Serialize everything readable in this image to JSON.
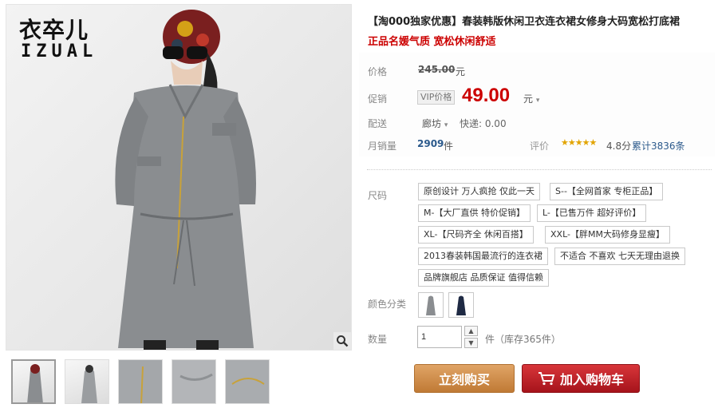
{
  "gallery": {
    "brand_cn": "衣卒儿",
    "brand_en": "IZUAL",
    "zoom_icon": "magnifier-icon",
    "thumbnails": [
      "thumb-1",
      "thumb-2",
      "thumb-3",
      "thumb-4",
      "thumb-5"
    ]
  },
  "product": {
    "title": "【淘000独家优惠】春装韩版休闲卫衣连衣裙女修身大码宽松打底裙",
    "subtitle": "正品名媛气质 宽松休闲舒适"
  },
  "price": {
    "label": "价格",
    "original": "245.00",
    "original_unit": "元",
    "promo_label": "促销",
    "vip_tag": "VIP价格",
    "current": "49.00",
    "current_unit": "元"
  },
  "shipping": {
    "label": "配送",
    "location": "廊坊",
    "express": "快递: 0.00"
  },
  "sales": {
    "label": "月销量",
    "count": "2909",
    "unit": "件",
    "review_label": "评价",
    "stars": "★★★★★",
    "rating": 4.8,
    "score": "4.8分",
    "reviews": "累计3836条"
  },
  "size": {
    "label": "尺码",
    "options": [
      "原创设计 万人疯抢 仅此一天",
      "S--【全网首家 专柜正品】",
      "M-【大厂直供 特价促销】",
      "L-【已售万件 超好评价】",
      "XL-【尺码齐全 休闲百搭】",
      "XXL-【胖MM大码修身显瘦】",
      "2013春装韩国最流行的连衣裙",
      "不适合 不喜欢 七天无理由退换",
      "品牌旗舰店 品质保证 值得信赖"
    ]
  },
  "color": {
    "label": "颜色分类",
    "swatches": [
      "grey-dress",
      "navy-dress"
    ]
  },
  "quantity": {
    "label": "数量",
    "value": "1",
    "stock": "件（库存365件）"
  },
  "actions": {
    "buy_now": "立刻购买",
    "add_to_cart": "加入购物车",
    "cart_icon": "cart-icon"
  }
}
